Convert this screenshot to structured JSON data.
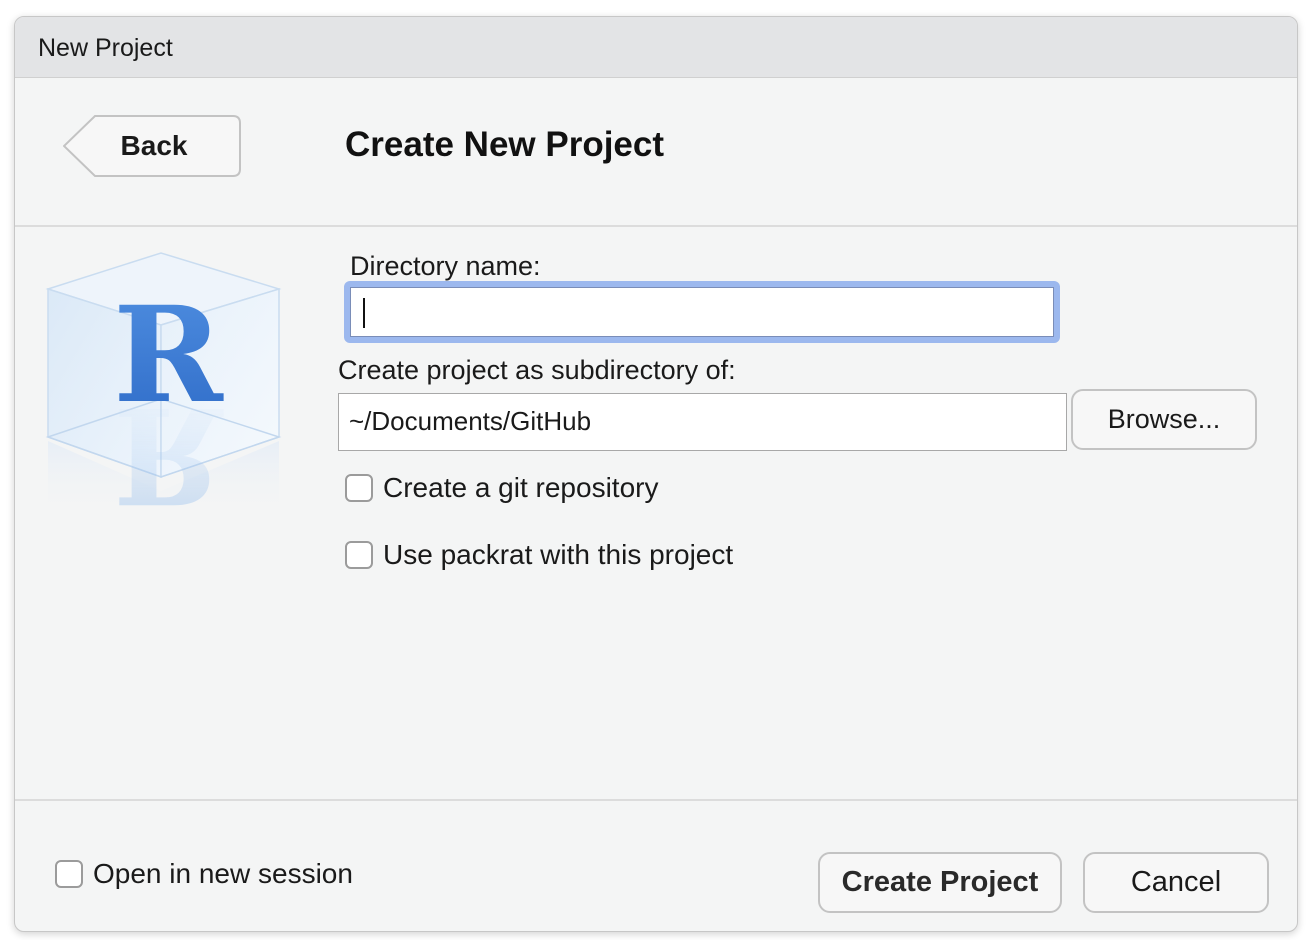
{
  "window": {
    "title": "New Project"
  },
  "header": {
    "back_label": "Back",
    "heading": "Create New Project"
  },
  "logo": {
    "letter": "R",
    "icon": "r-cube-logo-icon"
  },
  "form": {
    "directory_label": "Directory name:",
    "directory_value": "",
    "subdirectory_label": "Create project as subdirectory of:",
    "subdirectory_value": "~/Documents/GitHub",
    "browse_label": "Browse...",
    "git_label": "Create a git repository",
    "git_checked": false,
    "packrat_label": "Use packrat with this project",
    "packrat_checked": false
  },
  "footer": {
    "new_session_label": "Open in new session",
    "new_session_checked": false,
    "create_label": "Create Project",
    "cancel_label": "Cancel"
  },
  "colors": {
    "focus_ring": "#9cb8ee",
    "logo_blue": "#3b78d0"
  }
}
